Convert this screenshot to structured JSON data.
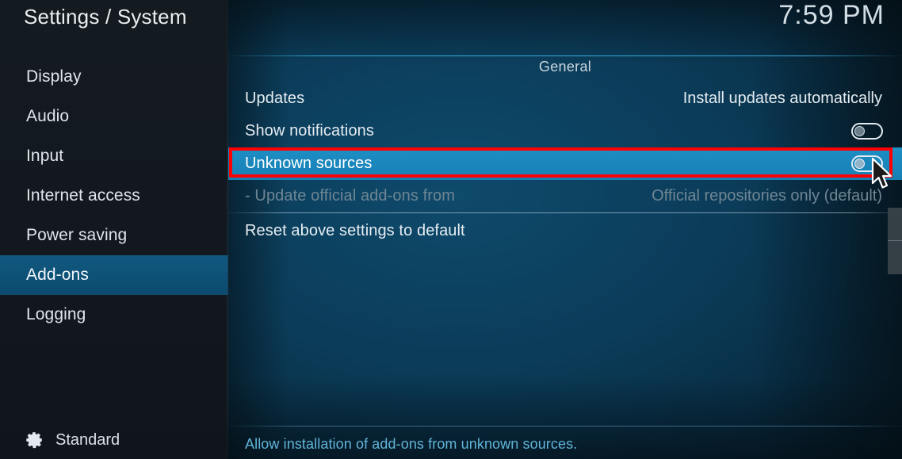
{
  "window": {
    "title": "Settings / System",
    "clock": "7:59 PM"
  },
  "sidebar": {
    "items": [
      {
        "label": "Display",
        "selected": false
      },
      {
        "label": "Audio",
        "selected": false
      },
      {
        "label": "Input",
        "selected": false
      },
      {
        "label": "Internet access",
        "selected": false
      },
      {
        "label": "Power saving",
        "selected": false
      },
      {
        "label": "Add-ons",
        "selected": true
      },
      {
        "label": "Logging",
        "selected": false
      }
    ],
    "profile": {
      "icon": "gear-icon",
      "label": "Standard"
    }
  },
  "main": {
    "group_header": "General",
    "rows": [
      {
        "label": "Updates",
        "value": "Install updates automatically",
        "control": "text",
        "state": "normal"
      },
      {
        "label": "Show notifications",
        "value": "",
        "control": "toggle",
        "toggle_on": false,
        "state": "normal"
      },
      {
        "label": "Unknown sources",
        "value": "",
        "control": "toggle",
        "toggle_on": false,
        "state": "highlighted"
      },
      {
        "label": "- Update official add-ons from",
        "value": "Official repositories only (default)",
        "control": "text",
        "state": "disabled"
      },
      {
        "label": "Reset above settings to default",
        "value": "",
        "control": "none",
        "state": "normal"
      }
    ],
    "footer_help": "Allow installation of add-ons from unknown sources."
  },
  "annotation": {
    "highlight_color": "#ff0000",
    "target_row": "Unknown sources"
  },
  "colors": {
    "accent": "#1a87bd",
    "sidebar_selected": "#0e5177",
    "help_text": "#62b4d8",
    "annotation_red": "#ff0000"
  },
  "cursor": {
    "type": "arrow-pointer"
  }
}
